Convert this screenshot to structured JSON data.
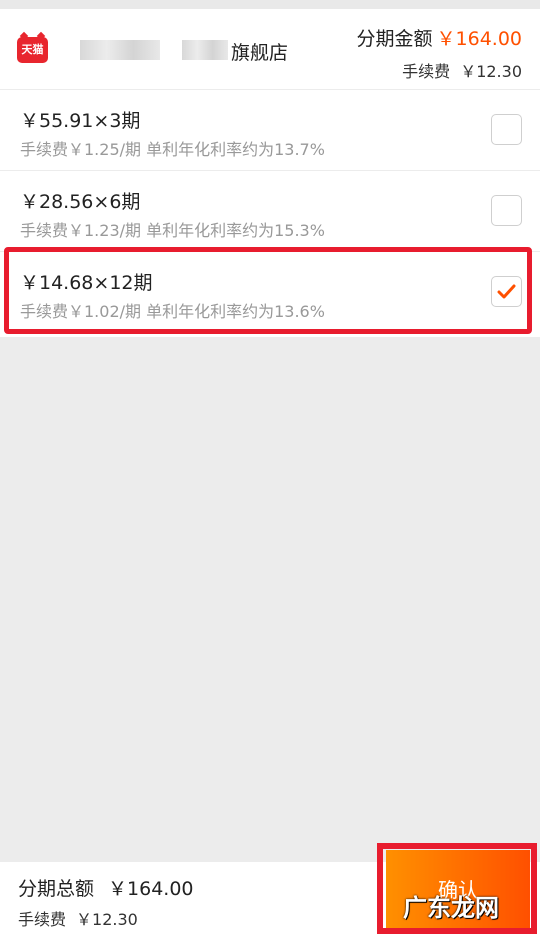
{
  "header": {
    "shop_logo_text": "天猫",
    "shop_suffix": "旗舰店",
    "amount_label": "分期金额",
    "amount_value": "￥164.00",
    "fee_label": "手续费",
    "fee_value": "￥12.30"
  },
  "plans": [
    {
      "main": "￥55.91×3期",
      "sub": "手续费￥1.25/期 单利年化利率约为13.7%",
      "checked": false
    },
    {
      "main": "￥28.56×6期",
      "sub": "手续费￥1.23/期 单利年化利率约为15.3%",
      "checked": false
    },
    {
      "main": "￥14.68×12期",
      "sub": "手续费￥1.02/期 单利年化利率约为13.6%",
      "checked": true
    }
  ],
  "footer": {
    "total_label": "分期总额",
    "total_value": "￥164.00",
    "fee_label": "手续费",
    "fee_value": "￥12.30",
    "confirm_label": "确认"
  },
  "watermark": "广东龙网",
  "colors": {
    "accent": "#ff5000",
    "highlight": "#e81c2e",
    "logo": "#e8262e"
  }
}
